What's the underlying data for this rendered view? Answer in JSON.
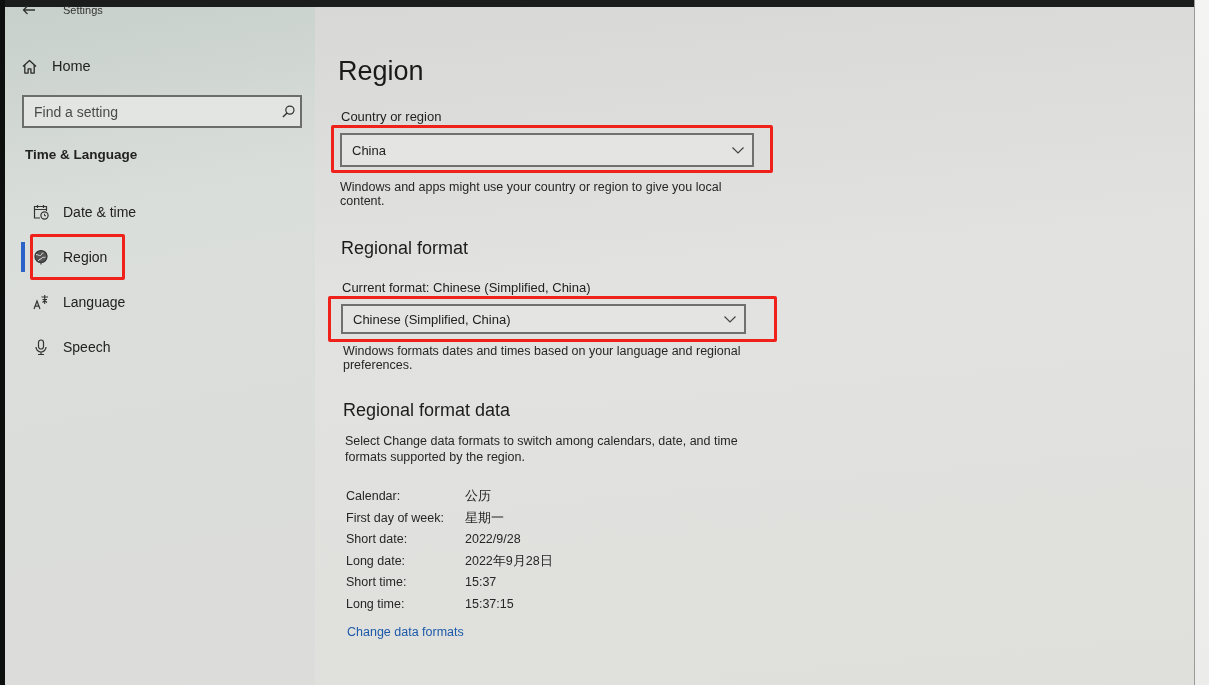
{
  "window": {
    "title": "Settings"
  },
  "sidebar": {
    "home": "Home",
    "search": {
      "placeholder": "Find a setting"
    },
    "section_title": "Time & Language",
    "items": [
      {
        "label": "Date & time",
        "selected": false,
        "highlighted": false
      },
      {
        "label": "Region",
        "selected": true,
        "highlighted": true
      },
      {
        "label": "Language",
        "selected": false,
        "highlighted": false
      },
      {
        "label": "Speech",
        "selected": false,
        "highlighted": false
      }
    ]
  },
  "page": {
    "title": "Region",
    "country": {
      "label": "Country or region",
      "value": "China",
      "highlighted": true,
      "description": "Windows and apps might use your country or region to give you local content."
    },
    "regional_format": {
      "heading": "Regional format",
      "label": "Current format: Chinese (Simplified, China)",
      "value": "Chinese (Simplified, China)",
      "highlighted": true,
      "description": "Windows formats dates and times based on your language and regional preferences."
    },
    "format_data": {
      "heading": "Regional format data",
      "description": "Select Change data formats to switch among calendars, date, and time formats supported by the region.",
      "rows": [
        {
          "label": "Calendar:",
          "value": "公历"
        },
        {
          "label": "First day of week:",
          "value": "星期一"
        },
        {
          "label": "Short date:",
          "value": "2022/9/28"
        },
        {
          "label": "Long date:",
          "value": "2022年9月28日"
        },
        {
          "label": "Short time:",
          "value": "15:37"
        },
        {
          "label": "Long time:",
          "value": "15:37:15"
        }
      ],
      "link": "Change data formats"
    }
  }
}
